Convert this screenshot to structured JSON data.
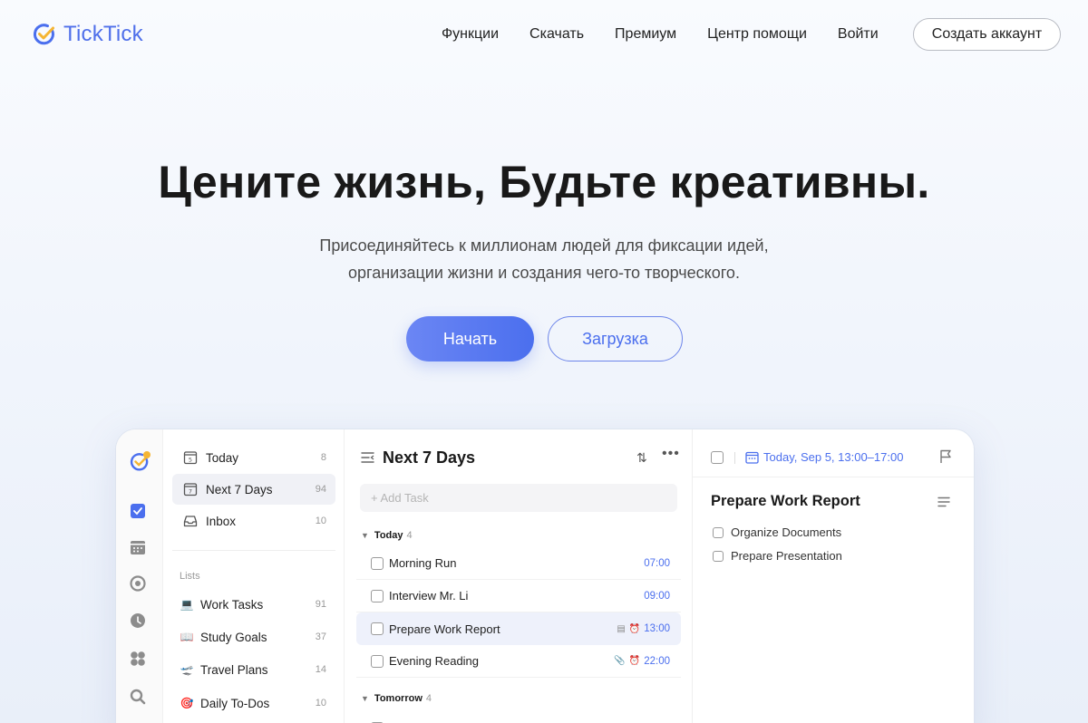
{
  "brand": {
    "name": "TickTick",
    "accent": "#4b6fee",
    "check_color": "#f5b533"
  },
  "nav": {
    "items": [
      "Функции",
      "Скачать",
      "Премиум",
      "Центр помощи",
      "Войти"
    ],
    "signup": "Создать аккаунт"
  },
  "hero": {
    "title": "Цените жизнь, Будьте креативны.",
    "subtitle_line1": "Присоединяйтесь к миллионам людей для фиксации идей,",
    "subtitle_line2": "организации жизни и создания чего-то творческого.",
    "start_button": "Начать",
    "download_button": "Загрузка"
  },
  "app": {
    "rail_icons": [
      "ticktick-logo-icon",
      "checkbox-icon",
      "calendar-icon",
      "focus-timer-icon",
      "habit-icon",
      "matrix-icon",
      "search-icon"
    ],
    "smart_lists": [
      {
        "label": "Today",
        "count": "8",
        "icon": "calendar-day-icon"
      },
      {
        "label": "Next 7 Days",
        "count": "94",
        "icon": "calendar-week-icon",
        "active": true
      },
      {
        "label": "Inbox",
        "count": "10",
        "icon": "inbox-icon"
      }
    ],
    "lists_header": "Lists",
    "lists": [
      {
        "label": "Work Tasks",
        "count": "91",
        "emoji": "💻"
      },
      {
        "label": "Study Goals",
        "count": "37",
        "emoji": "📖"
      },
      {
        "label": "Travel Plans",
        "count": "14",
        "emoji": "🛫"
      },
      {
        "label": "Daily To-Dos",
        "count": "10",
        "emoji": "🎯"
      }
    ],
    "task_view": {
      "title": "Next 7 Days",
      "add_placeholder": "+ Add Task",
      "sections": [
        {
          "name": "Today",
          "count": "4",
          "tasks": [
            {
              "title": "Morning Run",
              "time": "07:00"
            },
            {
              "title": "Interview Mr. Li",
              "time": "09:00"
            },
            {
              "title": "Prepare Work Report",
              "time": "13:00",
              "active": true,
              "has_note": true,
              "has_alarm": true
            },
            {
              "title": "Evening Reading",
              "time": "22:00",
              "has_attachment": true,
              "has_alarm": true
            }
          ]
        },
        {
          "name": "Tomorrow",
          "count": "4",
          "tasks": []
        }
      ]
    },
    "detail": {
      "date": "Today, Sep 5, 13:00–17:00",
      "title": "Prepare Work Report",
      "subtasks": [
        "Organize Documents",
        "Prepare Presentation"
      ]
    }
  }
}
